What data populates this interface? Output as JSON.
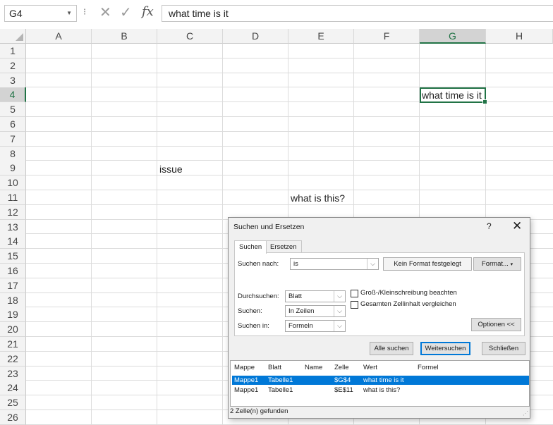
{
  "formula_bar": {
    "name_box": "G4",
    "fx_label": "fx",
    "formula": "what time is it"
  },
  "sheet": {
    "columns": [
      "A",
      "B",
      "C",
      "D",
      "E",
      "F",
      "G",
      "H"
    ],
    "selected_column": "G",
    "rows": [
      "1",
      "2",
      "3",
      "4",
      "5",
      "6",
      "7",
      "8",
      "9",
      "10",
      "11",
      "12",
      "13",
      "14",
      "15",
      "16",
      "17",
      "18",
      "19",
      "20",
      "21",
      "22",
      "23",
      "24",
      "25",
      "26"
    ],
    "selected_row": "4",
    "cells": {
      "C9": "issue",
      "E11": "what is this?",
      "G4": "what time is it"
    }
  },
  "dialog": {
    "title": "Suchen und Ersetzen",
    "help": "?",
    "close": "✕",
    "tabs": [
      "Suchen",
      "Ersetzen"
    ],
    "active_tab": "Suchen",
    "search_label": "Suchen nach:",
    "search_value": "is",
    "format_status": "Kein Format festgelegt",
    "format_button": "Format...",
    "within_label": "Durchsuchen:",
    "within_value": "Blatt",
    "search_order_label": "Suchen:",
    "search_order_value": "In Zeilen",
    "look_in_label": "Suchen in:",
    "look_in_value": "Formeln",
    "match_case_label": "Groß-/Kleinschreibung beachten",
    "match_entire_label": "Gesamten Zellinhalt vergleichen",
    "options_button": "Optionen <<",
    "find_all_button": "Alle suchen",
    "find_next_button": "Weitersuchen",
    "close_button": "Schließen",
    "results": {
      "headers": [
        "Mappe",
        "Blatt",
        "Name",
        "Zelle",
        "Wert",
        "Formel"
      ],
      "rows": [
        {
          "mappe": "Mappe1",
          "blatt": "Tabelle1",
          "name": "",
          "zelle": "$G$4",
          "wert": "what time is it",
          "formel": ""
        },
        {
          "mappe": "Mappe1",
          "blatt": "Tabelle1",
          "name": "",
          "zelle": "$E$11",
          "wert": "what is this?",
          "formel": ""
        }
      ]
    },
    "status": "2 Zelle(n) gefunden"
  },
  "colors": {
    "excel_green": "#217346",
    "selection_blue": "#0078d7"
  }
}
